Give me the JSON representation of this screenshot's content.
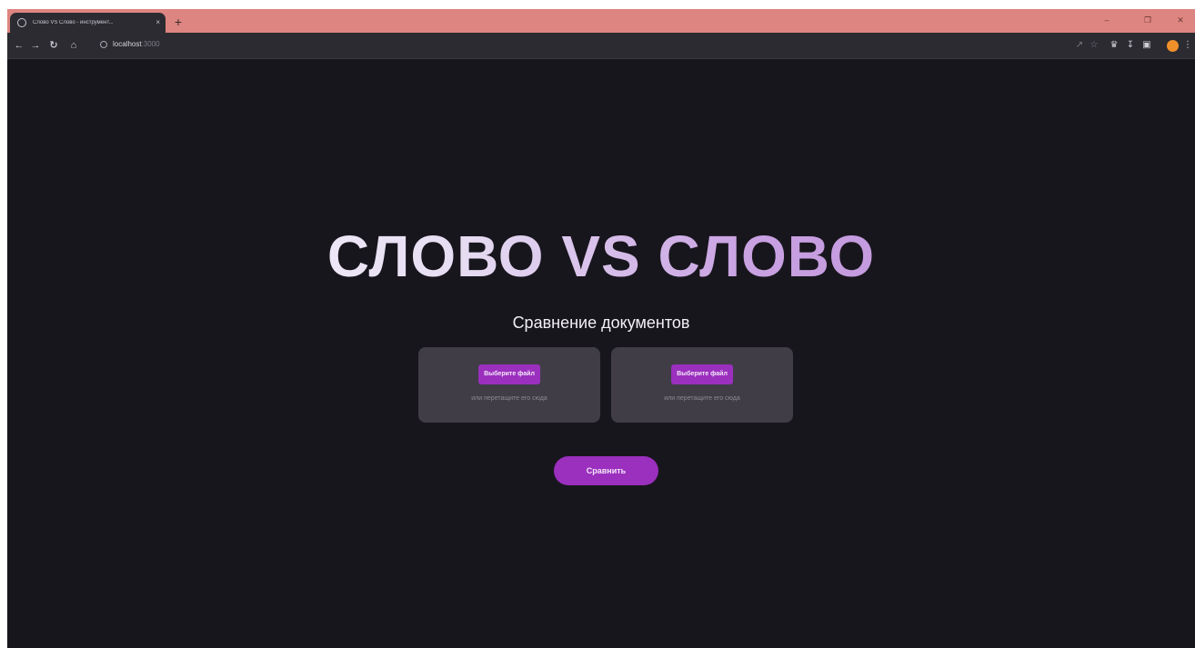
{
  "browser": {
    "tab_title": "Слово VS Слово - инструмент...",
    "tab_close": "×",
    "new_tab": "+",
    "url_host": "localhost",
    "url_port": ":3000",
    "window_controls": {
      "minimize": "–",
      "restore": "❐",
      "close": "✕"
    },
    "icons": [
      "back-icon",
      "forward-icon",
      "reload-icon",
      "home-icon",
      "share-icon",
      "star-icon",
      "extension-icon",
      "download-icon",
      "sidebar-icon",
      "profile-avatar",
      "menu-icon"
    ]
  },
  "page": {
    "title": "СЛОВО VS СЛОВО",
    "subtitle": "Сравнение документов",
    "dropzones": [
      {
        "button_label": "Выберите файл",
        "hint": "или перетащите его сюда"
      },
      {
        "button_label": "Выберите файл",
        "hint": "или перетащите его сюда"
      }
    ],
    "compare_label": "Сравнить"
  },
  "colors": {
    "background": "#18161d",
    "dropzone": "#403d47",
    "accent": "#9b2fbe",
    "tabstrip": "#dd8580",
    "title_gradient_start": "#ffffff",
    "title_gradient_end": "#b98ad6"
  }
}
